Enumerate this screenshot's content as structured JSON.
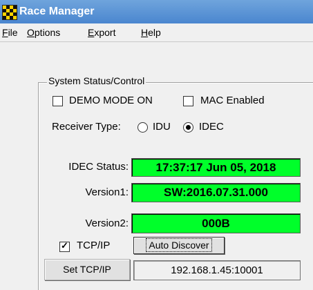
{
  "window": {
    "title": "Race Manager",
    "icon": "checkered-flag-icon"
  },
  "menu": {
    "file": {
      "hotkey": "F",
      "rest": "ile"
    },
    "options": {
      "hotkey": "O",
      "rest": "ptions"
    },
    "export": {
      "hotkey": "E",
      "rest": "xport"
    },
    "help": {
      "hotkey": "H",
      "rest": "elp"
    }
  },
  "system": {
    "legend": "System Status/Control",
    "demo_mode": {
      "label": "DEMO MODE ON",
      "checked": false
    },
    "mac_enabled": {
      "label": "MAC Enabled",
      "checked": false
    },
    "receiver_type": {
      "label": "Receiver Type:",
      "options": [
        "IDU",
        "IDEC"
      ],
      "selected": "IDEC"
    },
    "idec_status": {
      "label": "IDEC Status:",
      "value": "17:37:17 Jun 05, 2018"
    },
    "version1": {
      "label": "Version1:",
      "value": "SW:2016.07.31.000"
    },
    "version2": {
      "label": "Version2:",
      "value": "000B"
    },
    "tcpip": {
      "label": "TCP/IP",
      "checked": true
    },
    "auto_discover_label": "Auto Discover",
    "set_tcpip_label": "Set TCP/IP",
    "ip_address": "192.168.1.45:10001",
    "status_color": "#00ff2a"
  }
}
